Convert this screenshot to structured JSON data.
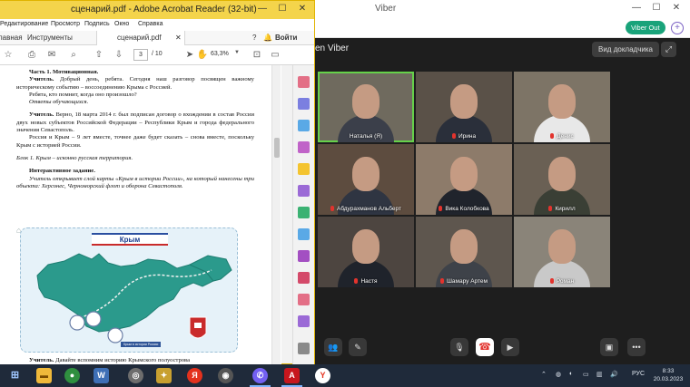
{
  "viber": {
    "title": "Viber",
    "viber_out": "Viber Out",
    "plus": "+",
    "call_name": "en Viber",
    "speaker_view": "Вид докладчика",
    "participants": [
      {
        "name": "Наталья (Я)",
        "active": true
      },
      {
        "name": "Ирина"
      },
      {
        "name": "Денис"
      },
      {
        "name": "Абдурахманов Альберт"
      },
      {
        "name": "Вика Колобкова"
      },
      {
        "name": "Кирилл"
      },
      {
        "name": "Настя"
      },
      {
        "name": "Шамару Артем"
      },
      {
        "name": "Роман"
      }
    ]
  },
  "acrobat": {
    "title": "сценарий.pdf - Adobe Acrobat Reader (32-bit)",
    "menu": [
      "Редактирование",
      "Просмотр",
      "Подпись",
      "Окно",
      "Справка"
    ],
    "tabs": {
      "home": "лавная",
      "tools": "Инструменты",
      "doc": "сценарий.pdf"
    },
    "sign_in": "Войти",
    "page_current": "3",
    "page_total": "/ 10",
    "zoom": "63,3%",
    "doc": {
      "heading1": "Часть 1. Мотивационная.",
      "p1_speaker": "Учитель.",
      "p1_text": "Добрый день, ребята. Сегодня наш разговор посвящен важному историческому событию – воссоединению Крыма с Россией.",
      "p2": "Ребята, кто помнит, когда оно произошло?",
      "p3": "Ответы обучающихся.",
      "p4_speaker": "Учитель.",
      "p4_text": "Верно, 18 марта 2014 г. был подписан договор о вхождении в состав России двух новых субъектов Российской Федерации – Республики Крым и города федерального значения Севастополь.",
      "p5": "Россия и Крым – 9 лет вместе, точнее даже будет сказать – снова вместе, поскольку Крым с историей России.",
      "p6": "Блок 1. Крым – исконно русская территория.",
      "heading2": "Интерактивное задание.",
      "p7": "Учитель открывает слой карты «Крым в истории России», на который нанесены три объекта: Херсонес, Черноморский флот и оборона Севастополя.",
      "map_title": "Крым",
      "map_legend": "Крым в истории России",
      "bottom_speaker": "Учитель.",
      "bottom_text": "Давайте вспомним историю Крымского полуострова"
    }
  },
  "taskbar": {
    "lang": "РУС",
    "time": "8:33",
    "date": "20.03.2023"
  }
}
